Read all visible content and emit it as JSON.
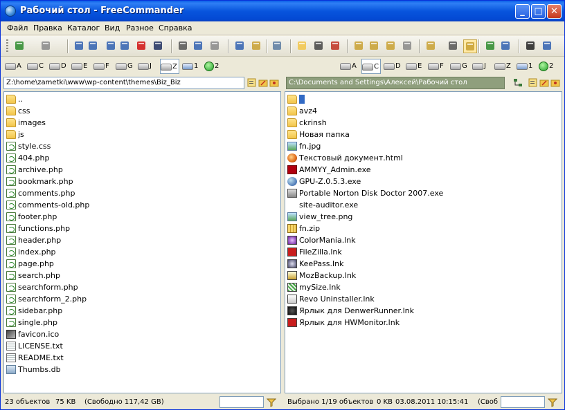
{
  "window": {
    "title": "Рабочий стол - FreeCommander",
    "min_glyph": "_",
    "max_glyph": "□",
    "close_glyph": "✕"
  },
  "menu": [
    "Файл",
    "Правка",
    "Каталог",
    "Вид",
    "Разное",
    "Справка"
  ],
  "toolbar_icons": [
    "back-icon",
    "forward-icon",
    "refresh-icon",
    "edit-icon",
    "copy-icon",
    "move-icon",
    "delete-icon",
    "find-icon",
    "cut-icon",
    "copy-clipboard-icon",
    "paste-icon",
    "download-icon",
    "upload-icon",
    "compare-icon",
    "new-folder-icon",
    "binoculars-icon",
    "filter-icon",
    "favorite-icon",
    "size-icon",
    "properties-icon",
    "print-icon",
    "tree-icon",
    "detail-view-icon",
    "thumbnail-view-icon",
    "sync-icon",
    "windows-icon",
    "cmd-icon",
    "notepad-icon"
  ],
  "left": {
    "drives": [
      {
        "letter": "A",
        "type": "floppy"
      },
      {
        "letter": "C",
        "type": "disk"
      },
      {
        "letter": "D",
        "type": "disk"
      },
      {
        "letter": "E",
        "type": "disk"
      },
      {
        "letter": "F",
        "type": "removable"
      },
      {
        "letter": "G",
        "type": "disk"
      },
      {
        "letter": "J",
        "type": "removable"
      },
      {
        "letter": "Z",
        "type": "disk",
        "selected": true
      },
      {
        "letter": "1",
        "type": "network"
      },
      {
        "letter": "2",
        "type": "ftp",
        "badge": "FTP"
      }
    ],
    "path": "Z:\\home\\zametki\\www\\wp-content\\themes\\Biz_Biz",
    "files": [
      {
        "name": "..",
        "icon": "folder"
      },
      {
        "name": "css",
        "icon": "folder"
      },
      {
        "name": "images",
        "icon": "folder"
      },
      {
        "name": "js",
        "icon": "folder"
      },
      {
        "name": "style.css",
        "icon": "php"
      },
      {
        "name": "404.php",
        "icon": "php"
      },
      {
        "name": "archive.php",
        "icon": "php"
      },
      {
        "name": "bookmark.php",
        "icon": "php"
      },
      {
        "name": "comments.php",
        "icon": "php"
      },
      {
        "name": "comments-old.php",
        "icon": "php"
      },
      {
        "name": "footer.php",
        "icon": "php"
      },
      {
        "name": "functions.php",
        "icon": "php"
      },
      {
        "name": "header.php",
        "icon": "php"
      },
      {
        "name": "index.php",
        "icon": "php"
      },
      {
        "name": "page.php",
        "icon": "php"
      },
      {
        "name": "search.php",
        "icon": "php"
      },
      {
        "name": "searchform.php",
        "icon": "php"
      },
      {
        "name": "searchform_2.php",
        "icon": "php"
      },
      {
        "name": "sidebar.php",
        "icon": "php"
      },
      {
        "name": "single.php",
        "icon": "php"
      },
      {
        "name": "favicon.ico",
        "icon": "ico"
      },
      {
        "name": "LICENSE.txt",
        "icon": "doc"
      },
      {
        "name": "README.txt",
        "icon": "doc"
      },
      {
        "name": "Thumbs.db",
        "icon": "db"
      }
    ],
    "status": {
      "count": "23 объектов",
      "size": "75 KB",
      "free": "(Свободно 117,42 GB)"
    }
  },
  "right": {
    "drives": [
      {
        "letter": "A",
        "type": "floppy"
      },
      {
        "letter": "C",
        "type": "disk",
        "selected": true
      },
      {
        "letter": "D",
        "type": "disk"
      },
      {
        "letter": "E",
        "type": "disk"
      },
      {
        "letter": "F",
        "type": "removable"
      },
      {
        "letter": "G",
        "type": "disk"
      },
      {
        "letter": "J",
        "type": "removable"
      },
      {
        "letter": "Z",
        "type": "disk"
      },
      {
        "letter": "1",
        "type": "network"
      },
      {
        "letter": "2",
        "type": "ftp",
        "badge": "FTP"
      }
    ],
    "path": "C:\\Documents and Settings\\Алексей\\Рабочий стол",
    "files": [
      {
        "name": "",
        "icon": "folder",
        "selected": true
      },
      {
        "name": "avz4",
        "icon": "folder"
      },
      {
        "name": "ckrinsh",
        "icon": "folder"
      },
      {
        "name": "Новая папка",
        "icon": "folder"
      },
      {
        "name": "fn.jpg",
        "icon": "img"
      },
      {
        "name": "Текстовый документ.html",
        "icon": "html"
      },
      {
        "name": "AMMYY_Admin.exe",
        "icon": "exe-red"
      },
      {
        "name": "GPU-Z.0.5.3.exe",
        "icon": "exe-blue"
      },
      {
        "name": "Portable Norton Disk Doctor 2007.exe",
        "icon": "exe-gray"
      },
      {
        "name": "site-auditor.exe",
        "icon": "exe-cursor"
      },
      {
        "name": "view_tree.png",
        "icon": "img"
      },
      {
        "name": "fn.zip",
        "icon": "zip"
      },
      {
        "name": "ColorMania.lnk",
        "icon": "lnk l1"
      },
      {
        "name": "FileZilla.lnk",
        "icon": "lnk l2"
      },
      {
        "name": "KeePass.lnk",
        "icon": "lnk l3"
      },
      {
        "name": "MozBackup.lnk",
        "icon": "lnk l4"
      },
      {
        "name": "mySize.lnk",
        "icon": "lnk l5"
      },
      {
        "name": "Revo Uninstaller.lnk",
        "icon": "lnk l6"
      },
      {
        "name": "Ярлык для DenwerRunner.lnk",
        "icon": "lnk l7"
      },
      {
        "name": "Ярлык для HWMonitor.lnk",
        "icon": "lnk l8"
      }
    ],
    "status": {
      "count": "Выбрано 1/19 объектов",
      "size": "0 KB",
      "date": "03.08.2011 10:15:41",
      "free": "(Своб"
    }
  }
}
